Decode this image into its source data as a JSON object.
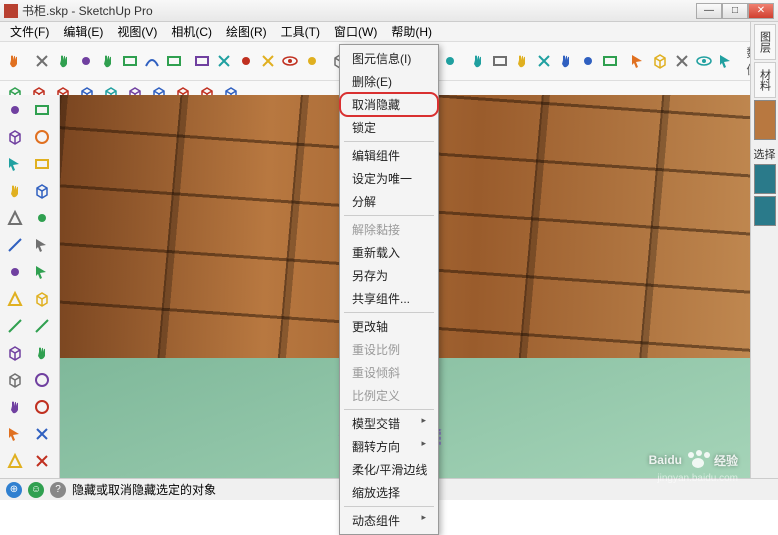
{
  "window": {
    "title": "书柜.skp - SketchUp Pro",
    "buttons": {
      "min": "—",
      "max": "□",
      "close": "✕"
    }
  },
  "menu": [
    "文件(F)",
    "编辑(E)",
    "视图(V)",
    "相机(C)",
    "绘图(R)",
    "工具(T)",
    "窗口(W)",
    "帮助(H)"
  ],
  "value_label": "数值",
  "context_menu": {
    "items": [
      {
        "label": "图元信息(I)",
        "enabled": true
      },
      {
        "label": "删除(E)",
        "enabled": true
      },
      {
        "label": "取消隐藏",
        "enabled": true,
        "highlight": true
      },
      {
        "label": "锁定",
        "enabled": true
      },
      {
        "sep": true
      },
      {
        "label": "编辑组件",
        "enabled": true
      },
      {
        "label": "设定为唯一",
        "enabled": true
      },
      {
        "label": "分解",
        "enabled": true
      },
      {
        "sep": true
      },
      {
        "label": "解除黏接",
        "enabled": false
      },
      {
        "label": "重新载入",
        "enabled": true
      },
      {
        "label": "另存为",
        "enabled": true
      },
      {
        "label": "共享组件...",
        "enabled": true
      },
      {
        "sep": true
      },
      {
        "label": "更改轴",
        "enabled": true
      },
      {
        "label": "重设比例",
        "enabled": false
      },
      {
        "label": "重设倾斜",
        "enabled": false
      },
      {
        "label": "比例定义",
        "enabled": false
      },
      {
        "sep": true
      },
      {
        "label": "模型交错",
        "enabled": true,
        "arrow": true
      },
      {
        "label": "翻转方向",
        "enabled": true,
        "arrow": true
      },
      {
        "label": "柔化/平滑边线",
        "enabled": true
      },
      {
        "label": "缩放选择",
        "enabled": true
      },
      {
        "sep": true
      },
      {
        "label": "动态组件",
        "enabled": true,
        "arrow": true
      }
    ]
  },
  "right_tabs": [
    "图层",
    "材料"
  ],
  "right_label": "选择",
  "swatches": [
    "#b87840",
    "#2a7a8a",
    "#2a7a8a"
  ],
  "status": {
    "hint": "隐藏或取消隐藏选定的对象"
  },
  "watermark": {
    "brand": "Baidu",
    "suffix": "经验",
    "url": "jingyan.baidu.com"
  },
  "toolbar_icons_row1": [
    "select",
    "eraser",
    "line",
    "freehand",
    "rect",
    "circle",
    "poly",
    "pushpull",
    "move",
    "rotate",
    "scale",
    "offset",
    "tape",
    "protractor",
    "axes",
    "dim",
    "text",
    "section",
    "pan",
    "orbit",
    "zoom",
    "zoomext",
    "prev",
    "next",
    "position",
    "walk",
    "look",
    "sandbox",
    "style",
    "layers",
    "shadows",
    "fog"
  ],
  "toolbar_icons_row2": [
    "surf1",
    "surf2",
    "surf3",
    "surf4",
    "surf5",
    "surf6",
    "surf7",
    "surf8",
    "surf9",
    "surf10"
  ],
  "left_icons": [
    "select",
    "eraser",
    "paint",
    "brush",
    "line",
    "free",
    "rect",
    "rrect",
    "circle",
    "arc",
    "arc2",
    "pie",
    "poly",
    "3dtext",
    "push",
    "follow",
    "offset",
    "move",
    "rotate",
    "scale",
    "tape",
    "dim",
    "protract",
    "text",
    "axes",
    "section",
    "orbit",
    "pan",
    "zoom",
    "zoomw"
  ],
  "status_icons": [
    "geo",
    "person",
    "help"
  ],
  "icon_colors": {
    "red": "#c03020",
    "blue": "#3060c0",
    "green": "#30a050",
    "yellow": "#e0b020",
    "gray": "#707070",
    "teal": "#20a0a0",
    "purple": "#7040a0",
    "orange": "#e07020"
  }
}
